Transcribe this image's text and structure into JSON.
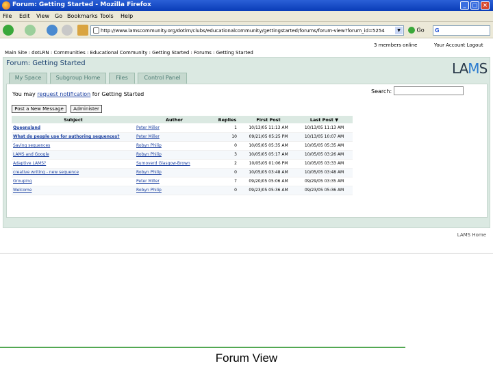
{
  "window": {
    "title": "Forum: Getting Started - Mozilla Firefox"
  },
  "menu": [
    "File",
    "Edit",
    "View",
    "Go",
    "Bookmarks",
    "Tools",
    "Help"
  ],
  "nav": {
    "url": "http://www.lamscommunity.org/dotlrn/clubs/educationalcommunity/gettingstarted/forums/forum-view?forum_id=5254",
    "go_label": "Go"
  },
  "page": {
    "breadcrumb": "Main Site : dotLRN : Communities : Educational Community : Getting Started : Forums : Getting Started",
    "members_online": "3 members online",
    "account": "Your Account   Logout",
    "forum_title": "Forum: Getting Started",
    "logo": {
      "pre": "LA",
      "mid": "M",
      "post": "S"
    },
    "tabs": [
      "My Space",
      "Subgroup Home",
      "Files",
      "Control Panel"
    ],
    "notify_prefix": "You may ",
    "notify_link": "request notification",
    "notify_suffix": " for Getting Started",
    "search_label": "Search:",
    "buttons": {
      "post": "Post a New Message",
      "admin": "Administer"
    },
    "table": {
      "headers": [
        "Subject",
        "Author",
        "Replies",
        "First Post",
        "Last Post ▼"
      ],
      "rows": [
        {
          "subject": "Queensland",
          "author": "Peter Miller",
          "replies": "1",
          "first": "10/13/05 11:13 AM",
          "last": "10/13/05 11:13 AM",
          "bold": true
        },
        {
          "subject": "What do people use for authoring sequences?",
          "author": "Peter Miller",
          "replies": "10",
          "first": "09/21/05 05:25 PM",
          "last": "10/13/05 10:07 AM",
          "bold": true
        },
        {
          "subject": "Saving sequences",
          "author": "Robyn Philip",
          "replies": "0",
          "first": "10/05/05 05:35 AM",
          "last": "10/05/05 05:35 AM",
          "bold": false
        },
        {
          "subject": "LAMS and Google",
          "author": "Robyn Philip",
          "replies": "3",
          "first": "10/05/05 05:17 AM",
          "last": "10/05/05 03:26 AM",
          "bold": false
        },
        {
          "subject": "Adaptive LAMS?",
          "author": "Sumoverd Glasgow-Brown",
          "replies": "2",
          "first": "10/05/05 01:06 PM",
          "last": "10/05/05 03:33 AM",
          "bold": false
        },
        {
          "subject": "creative writing - new sequence",
          "author": "Robyn Philip",
          "replies": "0",
          "first": "10/05/05 03:48 AM",
          "last": "10/05/05 03:48 AM",
          "bold": false
        },
        {
          "subject": "Grouping",
          "author": "Peter Miller",
          "replies": "7",
          "first": "09/20/05 05:06 AM",
          "last": "09/29/05 03:35 AM",
          "bold": false
        },
        {
          "subject": "Welcome",
          "author": "Robyn Philip",
          "replies": "0",
          "first": "09/23/05 05:36 AM",
          "last": "09/23/05 05:36 AM",
          "bold": false
        }
      ]
    },
    "footer": "LAMS Home"
  },
  "caption": "Forum View"
}
